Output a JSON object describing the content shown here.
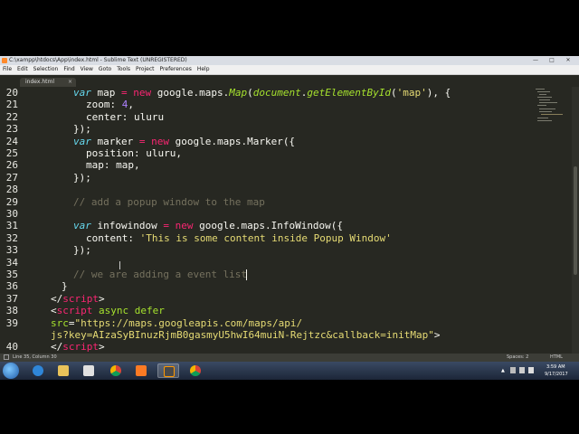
{
  "window": {
    "title": "C:\\xampp\\htdocs\\App\\index.html - Sublime Text (UNREGISTERED)",
    "controls": [
      "—",
      "□",
      "✕"
    ]
  },
  "menu": [
    "File",
    "Edit",
    "Selection",
    "Find",
    "View",
    "Goto",
    "Tools",
    "Project",
    "Preferences",
    "Help"
  ],
  "tab": {
    "label": "index.html",
    "close": "×"
  },
  "line_numbers": [
    "20",
    "21",
    "22",
    "23",
    "24",
    "25",
    "26",
    "27",
    "28",
    "29",
    "30",
    "31",
    "32",
    "33",
    "34",
    "35",
    "36",
    "37",
    "38",
    "39",
    "",
    "40"
  ],
  "code": {
    "l20": [
      "var",
      " map ",
      "=",
      " ",
      "new",
      " google.maps.",
      "Map",
      "(",
      "document",
      ".",
      "getElementById",
      "(",
      "'map'",
      "), {"
    ],
    "l21": [
      "zoom: ",
      "4",
      ","
    ],
    "l22": [
      "center: uluru"
    ],
    "l23": [
      "});"
    ],
    "l24": [
      "var",
      " marker ",
      "=",
      " ",
      "new",
      " google.maps.Marker({"
    ],
    "l25": [
      "position: uluru,"
    ],
    "l26": [
      "map: map,"
    ],
    "l27": [
      "});"
    ],
    "l29": [
      "// add a popup window to the map"
    ],
    "l31": [
      "var",
      " infowindow ",
      "=",
      " ",
      "new",
      " google.maps.InfoWindow({"
    ],
    "l32": [
      "content: ",
      "'This is some content inside Popup Window'"
    ],
    "l33": [
      "});"
    ],
    "l35": [
      "// we are adding a event list"
    ],
    "l36": [
      "}"
    ],
    "l37": [
      "</",
      "script",
      ">"
    ],
    "l38": [
      "<",
      "script",
      " ",
      "async",
      " ",
      "defer"
    ],
    "l39a": [
      "src",
      "=",
      "\"https://maps.googleapis.com/maps/api/"
    ],
    "l39b": [
      "js?key=AIzaSyBInuzRjmB0gasmyU5hwI64muiN-Rejtzc&callback=initMap\"",
      ">"
    ],
    "l40": [
      "</",
      "script",
      ">"
    ]
  },
  "status": {
    "left": "Line 35, Column 30",
    "spaces": "Spaces: 2",
    "syntax": "HTML"
  },
  "taskbar": {
    "apps": [
      "windows-explorer",
      "internet-explorer",
      "file-explorer",
      "media-player",
      "chrome",
      "xampp",
      "sublime-text",
      "chrome-2"
    ],
    "time": "3:59 AM",
    "date": "9/17/2017"
  },
  "colors": {
    "editor_bg": "#272822",
    "keyword": "#66d9ef",
    "operator": "#f92672",
    "function": "#a6e22e",
    "string": "#e6db74",
    "number": "#ae81ff",
    "comment": "#75715e"
  }
}
